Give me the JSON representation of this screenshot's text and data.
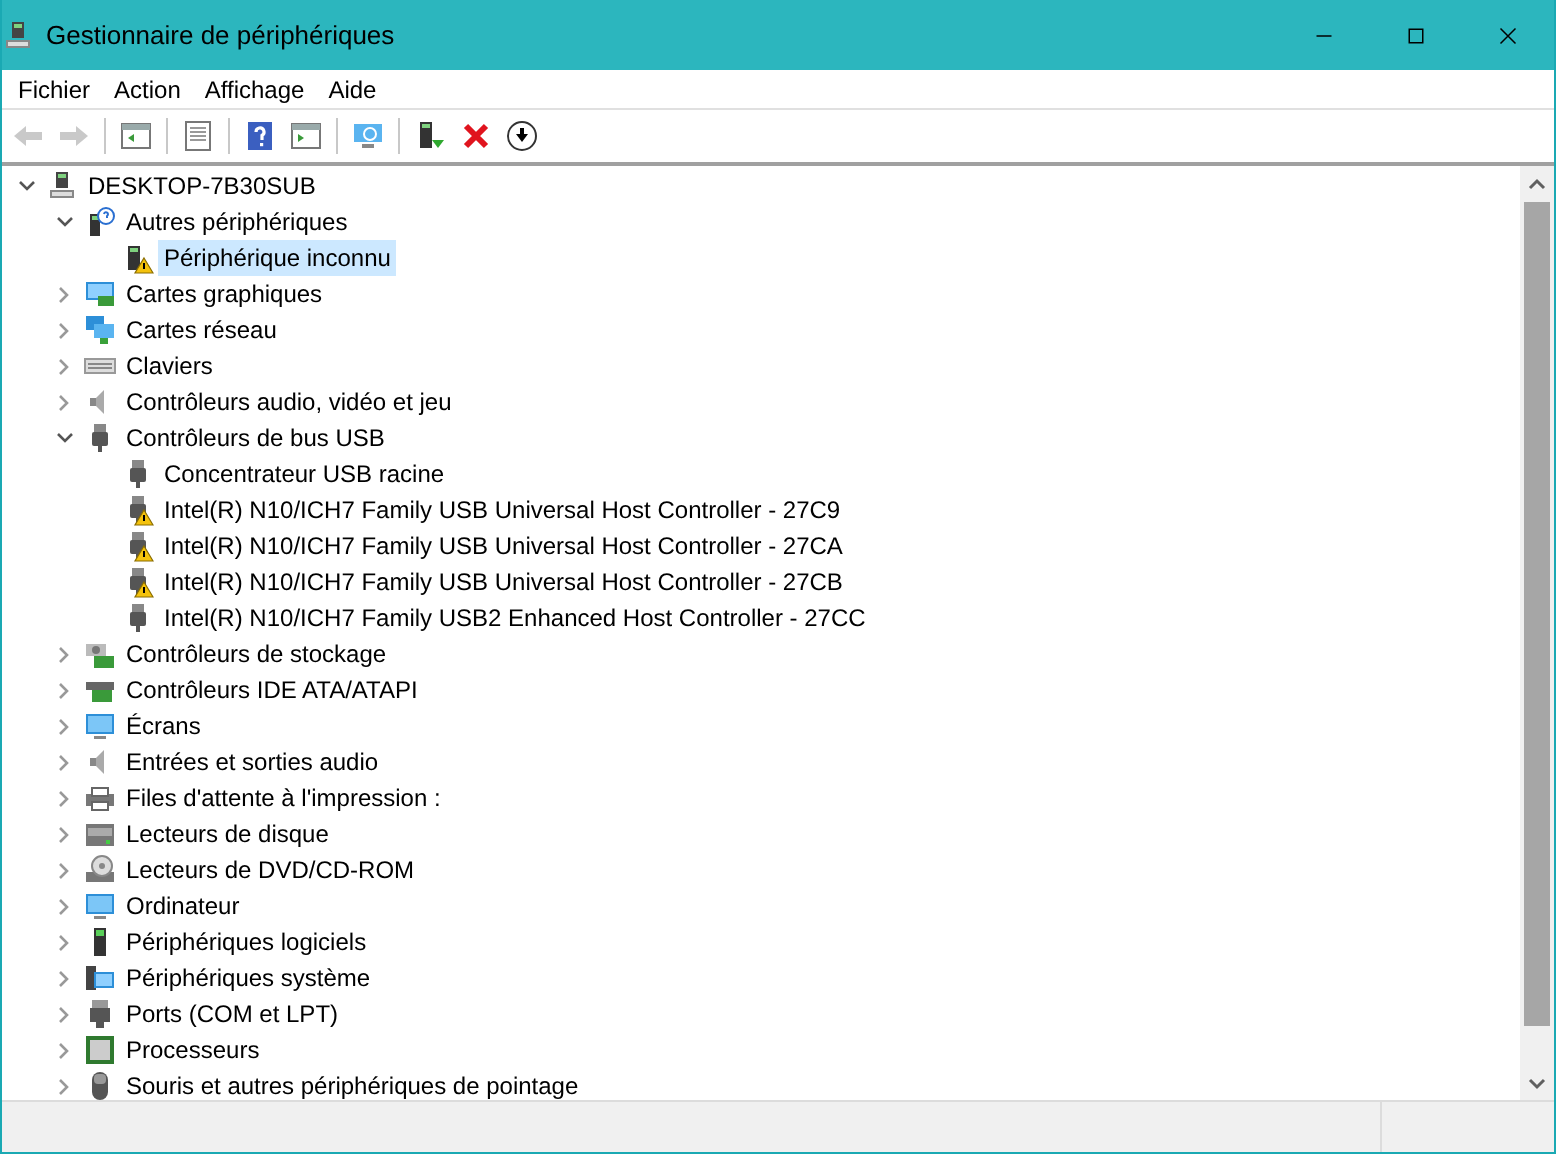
{
  "window": {
    "title": "Gestionnaire de périphériques",
    "controls": [
      {
        "kind": "minimize"
      },
      {
        "kind": "maximize"
      },
      {
        "kind": "close"
      }
    ]
  },
  "menu": [
    {
      "label": "Fichier"
    },
    {
      "label": "Action"
    },
    {
      "label": "Affichage"
    },
    {
      "label": "Aide"
    }
  ],
  "toolbar": [
    {
      "kind": "back",
      "disabled": true
    },
    {
      "kind": "forward",
      "disabled": true
    },
    {
      "kind": "separator"
    },
    {
      "kind": "console",
      "disabled": false
    },
    {
      "kind": "separator"
    },
    {
      "kind": "properties",
      "disabled": false
    },
    {
      "kind": "separator"
    },
    {
      "kind": "help",
      "disabled": false
    },
    {
      "kind": "panel",
      "disabled": false
    },
    {
      "kind": "separator"
    },
    {
      "kind": "scan",
      "disabled": false
    },
    {
      "kind": "separator"
    },
    {
      "kind": "update",
      "disabled": false
    },
    {
      "kind": "uninstall",
      "disabled": false
    },
    {
      "kind": "download",
      "disabled": false
    }
  ],
  "tree": [
    {
      "label": "DESKTOP-7B30SUB",
      "kind": "computer",
      "expanded": true,
      "selected": false,
      "children": [
        {
          "label": "Autres périphériques",
          "kind": "unknown",
          "expanded": true,
          "selected": false,
          "children": [
            {
              "label": "Périphérique inconnu",
              "kind": "device",
              "warning": true,
              "selected": true
            }
          ]
        },
        {
          "label": "Cartes graphiques",
          "kind": "display",
          "expanded": false,
          "selected": false
        },
        {
          "label": "Cartes réseau",
          "kind": "network",
          "expanded": false,
          "selected": false
        },
        {
          "label": "Claviers",
          "kind": "keyboard",
          "expanded": false,
          "selected": false
        },
        {
          "label": "Contrôleurs audio, vidéo et jeu",
          "kind": "audio",
          "expanded": false,
          "selected": false
        },
        {
          "label": "Contrôleurs de bus USB",
          "kind": "usb",
          "expanded": true,
          "selected": false,
          "children": [
            {
              "label": "Concentrateur USB racine",
              "kind": "usb",
              "warning": false,
              "selected": false
            },
            {
              "label": "Intel(R) N10/ICH7 Family USB Universal Host Controller - 27C9",
              "kind": "usb",
              "warning": true,
              "selected": false
            },
            {
              "label": "Intel(R) N10/ICH7 Family USB Universal Host Controller - 27CA",
              "kind": "usb",
              "warning": true,
              "selected": false
            },
            {
              "label": "Intel(R) N10/ICH7 Family USB Universal Host Controller - 27CB",
              "kind": "usb",
              "warning": true,
              "selected": false
            },
            {
              "label": "Intel(R) N10/ICH7 Family USB2 Enhanced Host Controller - 27CC",
              "kind": "usb",
              "warning": false,
              "selected": false
            }
          ]
        },
        {
          "label": "Contrôleurs de stockage",
          "kind": "storage",
          "expanded": false,
          "selected": false
        },
        {
          "label": "Contrôleurs IDE ATA/ATAPI",
          "kind": "ide",
          "expanded": false,
          "selected": false
        },
        {
          "label": "Écrans",
          "kind": "monitor",
          "expanded": false,
          "selected": false
        },
        {
          "label": "Entrées et sorties audio",
          "kind": "audio",
          "expanded": false,
          "selected": false
        },
        {
          "label": "Files d'attente à l'impression :",
          "kind": "printer",
          "expanded": false,
          "selected": false
        },
        {
          "label": "Lecteurs de disque",
          "kind": "disk",
          "expanded": false,
          "selected": false
        },
        {
          "label": "Lecteurs de DVD/CD-ROM",
          "kind": "dvd",
          "expanded": false,
          "selected": false
        },
        {
          "label": "Ordinateur",
          "kind": "monitor",
          "expanded": false,
          "selected": false
        },
        {
          "label": "Périphériques logiciels",
          "kind": "software",
          "expanded": false,
          "selected": false
        },
        {
          "label": "Périphériques système",
          "kind": "system",
          "expanded": false,
          "selected": false
        },
        {
          "label": "Ports (COM et LPT)",
          "kind": "port",
          "expanded": false,
          "selected": false
        },
        {
          "label": "Processeurs",
          "kind": "cpu",
          "expanded": false,
          "selected": false
        },
        {
          "label": "Souris et autres périphériques de pointage",
          "kind": "mouse",
          "expanded": false,
          "selected": false
        }
      ]
    }
  ]
}
